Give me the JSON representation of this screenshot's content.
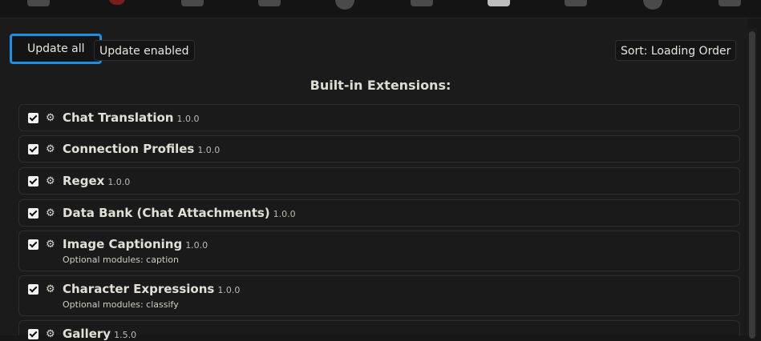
{
  "toolbar": {
    "update_all": "Update all",
    "update_enabled": "Update enabled",
    "sort": "Sort: Loading Order"
  },
  "section": {
    "title": "Built-in Extensions:"
  },
  "extensions": [
    {
      "name": "Chat Translation",
      "version": "1.0.0",
      "enabled": true,
      "modules": ""
    },
    {
      "name": "Connection Profiles",
      "version": "1.0.0",
      "enabled": true,
      "modules": ""
    },
    {
      "name": "Regex",
      "version": "1.0.0",
      "enabled": true,
      "modules": ""
    },
    {
      "name": "Data Bank (Chat Attachments)",
      "version": "1.0.0",
      "enabled": true,
      "modules": ""
    },
    {
      "name": "Image Captioning",
      "version": "1.0.0",
      "enabled": true,
      "modules": "Optional modules: caption"
    },
    {
      "name": "Character Expressions",
      "version": "1.0.0",
      "enabled": true,
      "modules": "Optional modules: classify"
    },
    {
      "name": "Gallery",
      "version": "1.5.0",
      "enabled": true,
      "modules": ""
    }
  ],
  "icons": {
    "gear": "gear-icon",
    "checkbox": "checkbox-checked-icon"
  },
  "colors": {
    "focus_ring": "#1b8fe6",
    "background": "#171717"
  }
}
